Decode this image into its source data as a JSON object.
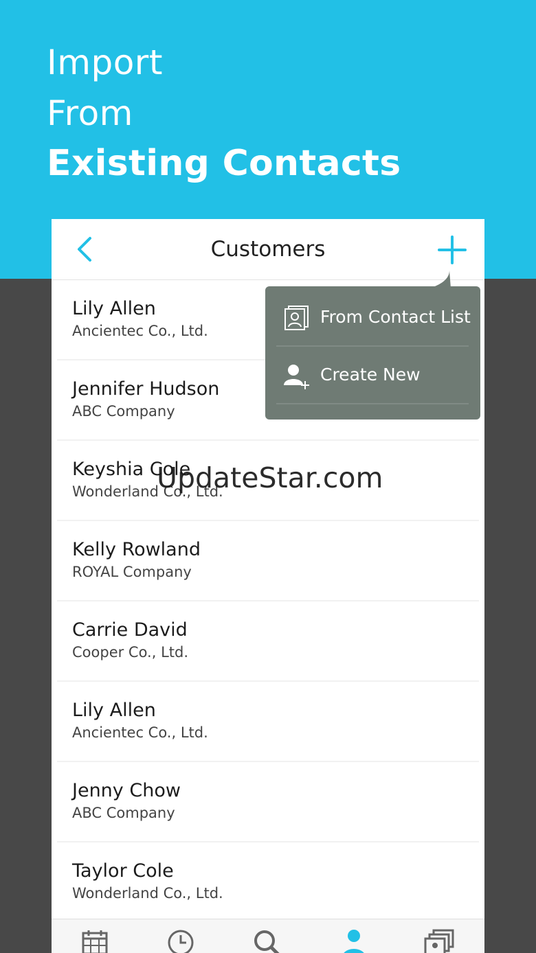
{
  "hero": {
    "line1": "Import",
    "line2": "From",
    "line3": "Existing Contacts"
  },
  "navbar": {
    "title": "Customers",
    "back_icon": "chevron-left-icon",
    "add_icon": "plus-icon"
  },
  "contacts": [
    {
      "name": "Lily Allen",
      "company": "Ancientec Co., Ltd."
    },
    {
      "name": "Jennifer Hudson",
      "company": "ABC Company"
    },
    {
      "name": "Keyshia Cole",
      "company": "Wonderland Co., Ltd."
    },
    {
      "name": "Kelly Rowland",
      "company": "ROYAL Company"
    },
    {
      "name": "Carrie David",
      "company": "Cooper Co., Ltd."
    },
    {
      "name": "Lily Allen",
      "company": "Ancientec Co., Ltd."
    },
    {
      "name": "Jenny Chow",
      "company": "ABC Company"
    },
    {
      "name": "Taylor Cole",
      "company": "Wonderland Co., Ltd."
    }
  ],
  "popup_menu": {
    "items": [
      {
        "label": "From Contact List",
        "icon": "contact-card-icon"
      },
      {
        "label": "Create New",
        "icon": "add-person-icon"
      }
    ]
  },
  "watermark": "UpdateStar.com",
  "tabbar": {
    "tabs": [
      {
        "icon": "calendar-icon",
        "active": false
      },
      {
        "icon": "clock-icon",
        "active": false
      },
      {
        "icon": "search-icon",
        "active": false
      },
      {
        "icon": "person-icon",
        "active": true
      },
      {
        "icon": "cards-icon",
        "active": false
      }
    ]
  },
  "colors": {
    "accent": "#22c0e6",
    "background": "#484848",
    "popup": "#6f7b74"
  }
}
